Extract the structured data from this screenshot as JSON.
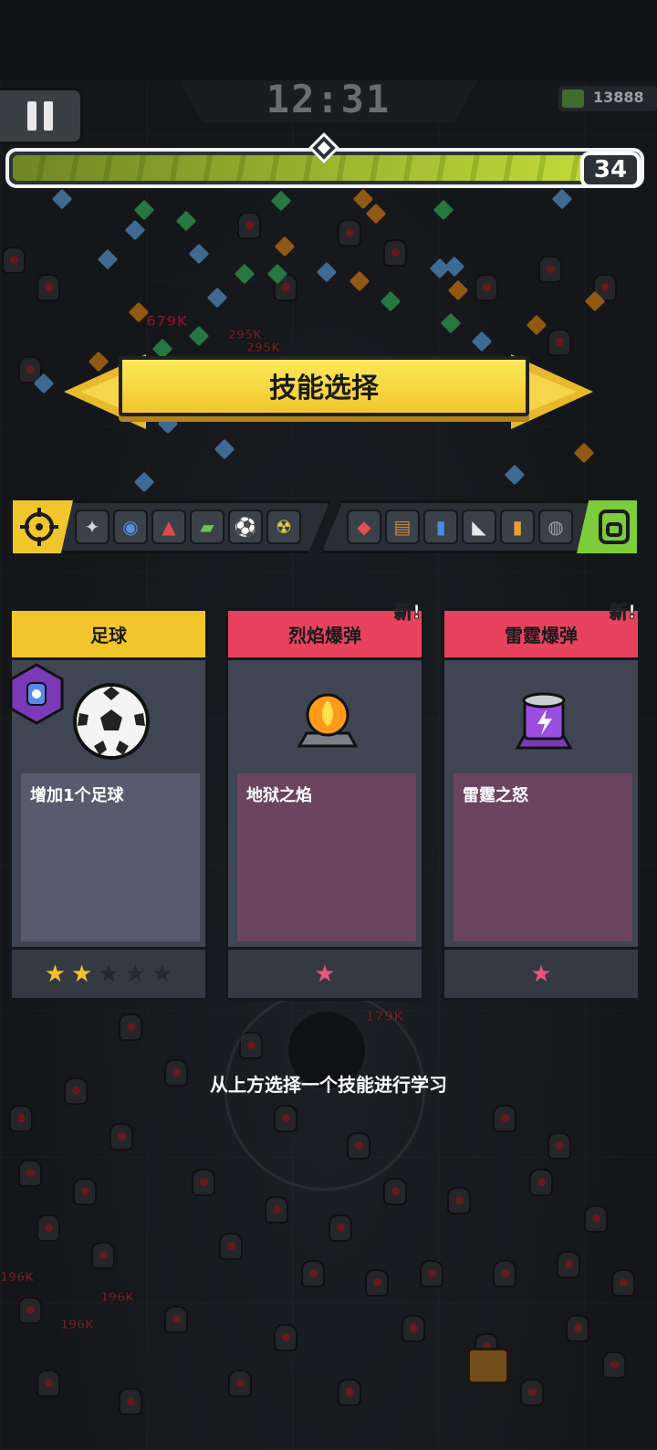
{
  "hud": {
    "timer": "12:31",
    "gold": "13888",
    "level": "34",
    "xp_progress": 0.97
  },
  "banner": {
    "title": "技能选择"
  },
  "equipment": {
    "weapons": [
      "wind-blade-icon",
      "drone-icon",
      "cone-icon",
      "bottle-icon",
      "soccer-ball-icon",
      "radiation-icon"
    ],
    "passives": [
      "ammo-icon",
      "book-icon",
      "drink-icon",
      "sneaker-icon",
      "battery-icon",
      "magnet-icon"
    ]
  },
  "cards": [
    {
      "title": "足球",
      "description": "增加1个足球",
      "icon": "soccer-ball-icon",
      "header_color": "#f1c62c",
      "stars_filled": 2,
      "stars_total": 5,
      "new": false
    },
    {
      "title": "烈焰爆弹",
      "description": "地狱之焰",
      "icon": "fire-bomb-icon",
      "header_color": "#e8425e",
      "stars_filled": 0,
      "stars_total": 1,
      "new": true,
      "new_label": "新!"
    },
    {
      "title": "雷霆爆弹",
      "description": "雷霆之怒",
      "icon": "thunder-bomb-icon",
      "header_color": "#e8425e",
      "stars_filled": 0,
      "stars_total": 1,
      "new": true,
      "new_label": "新!"
    }
  ],
  "hint": "从上方选择一个技能进行学习",
  "damage_numbers": [
    "679K",
    "295K",
    "295K",
    "179K",
    "196K",
    "196K",
    "196K"
  ]
}
